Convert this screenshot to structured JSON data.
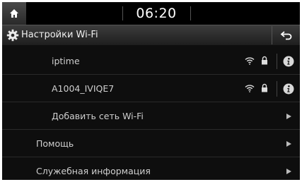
{
  "status_bar": {
    "time": "06:20"
  },
  "title_bar": {
    "title": "Настройки Wi-Fi"
  },
  "networks": [
    {
      "ssid": "iptime"
    },
    {
      "ssid": "A1004_IVIQE7"
    }
  ],
  "add_network_label": "Добавить сеть Wi-Fi",
  "menu_items": [
    {
      "label": "Помощь"
    },
    {
      "label": "Служебная информация"
    }
  ]
}
